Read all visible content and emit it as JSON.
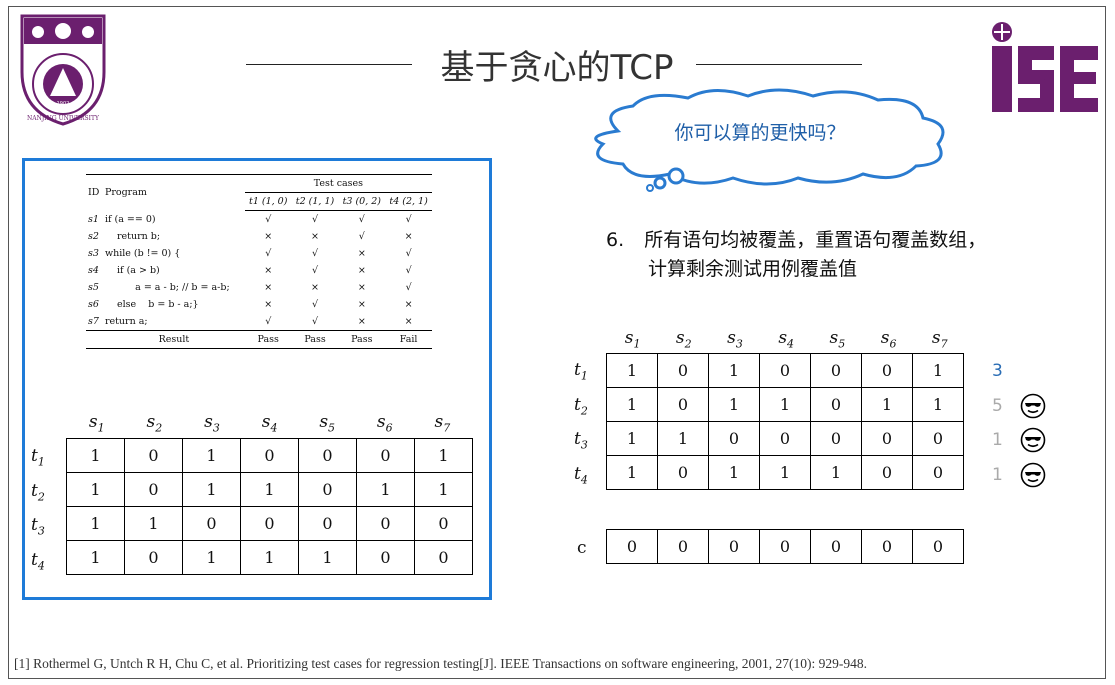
{
  "title": "基于贪心的TCP",
  "cloud_text": "你可以算的更快吗？",
  "note_number": "6.",
  "note_line1": "所有语句均被覆盖，重置语句覆盖数组，",
  "note_line2": "计算剩余测试用例覆盖值",
  "nju_logo": {
    "year": "1902",
    "text": "NANJING UNIVERSITY"
  },
  "ise_logo": {
    "text": "iSE",
    "color": "#6b1f6e"
  },
  "paper_table": {
    "headers": {
      "id": "ID",
      "program": "Program",
      "test_cases": "Test cases"
    },
    "test_cases": [
      "t1 (1, 0)",
      "t2 (1, 1)",
      "t3 (0, 2)",
      "t4 (2, 1)"
    ],
    "rows": [
      {
        "id": "s1",
        "program": "if (a == 0)",
        "marks": [
          "√",
          "√",
          "√",
          "√"
        ]
      },
      {
        "id": "s2",
        "program": "return b;",
        "marks": [
          "×",
          "×",
          "√",
          "×"
        ]
      },
      {
        "id": "s3",
        "program": "while (b != 0) {",
        "marks": [
          "√",
          "√",
          "×",
          "√"
        ]
      },
      {
        "id": "s4",
        "program": "if (a > b)",
        "marks": [
          "×",
          "√",
          "×",
          "√"
        ]
      },
      {
        "id": "s5",
        "program": "a = a - b; // b = a-b;",
        "marks": [
          "×",
          "×",
          "×",
          "√"
        ]
      },
      {
        "id": "s6",
        "program": "else    b = b - a;}",
        "marks": [
          "×",
          "√",
          "×",
          "×"
        ]
      },
      {
        "id": "s7",
        "program": "return a;",
        "marks": [
          "√",
          "√",
          "×",
          "×"
        ]
      }
    ],
    "result_label": "Result",
    "results": [
      "Pass",
      "Pass",
      "Pass",
      "Fail"
    ]
  },
  "matrix_cols": [
    "s1",
    "s2",
    "s3",
    "s4",
    "s5",
    "s6",
    "s7"
  ],
  "matrix_rows": [
    "t1",
    "t2",
    "t3",
    "t4"
  ],
  "left_matrix": [
    [
      1,
      0,
      1,
      0,
      0,
      0,
      1
    ],
    [
      1,
      0,
      1,
      1,
      0,
      1,
      1
    ],
    [
      1,
      1,
      0,
      0,
      0,
      0,
      0
    ],
    [
      1,
      0,
      1,
      1,
      1,
      0,
      0
    ]
  ],
  "right_matrix": [
    [
      1,
      0,
      1,
      0,
      0,
      0,
      1
    ],
    [
      1,
      0,
      1,
      1,
      0,
      1,
      1
    ],
    [
      1,
      1,
      0,
      0,
      0,
      0,
      0
    ],
    [
      1,
      0,
      1,
      1,
      1,
      0,
      0
    ]
  ],
  "scores": [
    {
      "value": "3",
      "color": "#2a6db5",
      "smiley": false
    },
    {
      "value": "5",
      "color": "#aaaaaa",
      "smiley": true
    },
    {
      "value": "1",
      "color": "#aaaaaa",
      "smiley": true
    },
    {
      "value": "1",
      "color": "#aaaaaa",
      "smiley": true
    }
  ],
  "c_label": "c",
  "c_array": [
    0,
    0,
    0,
    0,
    0,
    0,
    0
  ],
  "reference": "[1] Rothermel G, Untch R H, Chu C, et al. Prioritizing test cases for regression testing[J]. IEEE Transactions on software engineering, 2001, 27(10): 929-948."
}
